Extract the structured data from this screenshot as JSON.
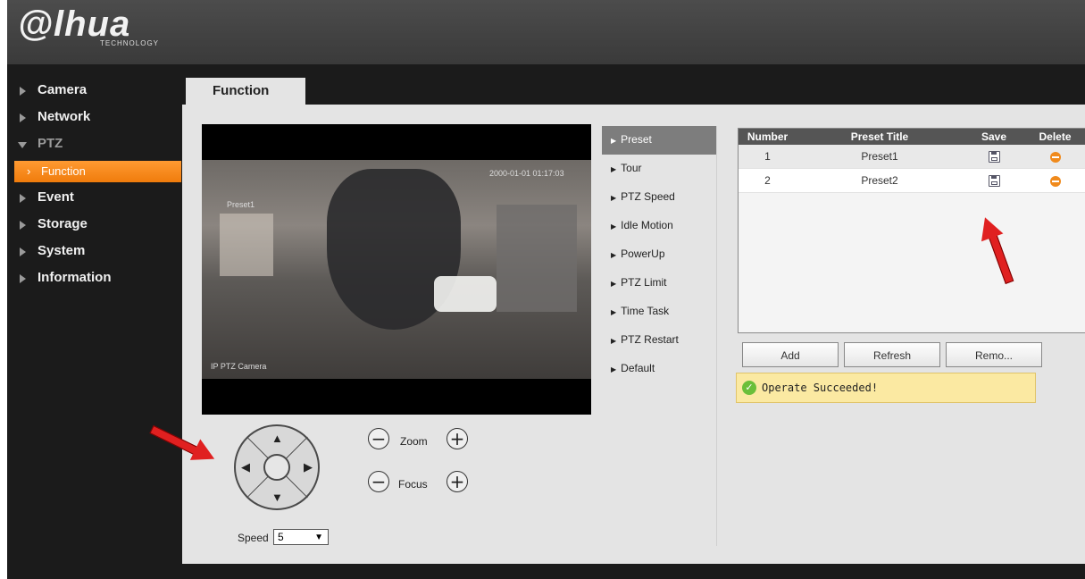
{
  "logo": {
    "main": "@lhua",
    "sub": "TECHNOLOGY"
  },
  "sidebar": {
    "items": [
      {
        "label": "Camera"
      },
      {
        "label": "Network"
      },
      {
        "label": "PTZ"
      },
      {
        "label": "Event"
      },
      {
        "label": "Storage"
      },
      {
        "label": "System"
      },
      {
        "label": "Information"
      }
    ],
    "sub_item": {
      "label": "Function"
    }
  },
  "tab": {
    "label": "Function"
  },
  "video": {
    "timestamp": "2000-01-01 01:17:03",
    "preset_osd": "Preset1",
    "camera_name": "IP PTZ Camera"
  },
  "ptz_menu": [
    {
      "label": "Preset"
    },
    {
      "label": "Tour"
    },
    {
      "label": "PTZ Speed"
    },
    {
      "label": "Idle Motion"
    },
    {
      "label": "PowerUp"
    },
    {
      "label": "PTZ Limit"
    },
    {
      "label": "Time Task"
    },
    {
      "label": "PTZ Restart"
    },
    {
      "label": "Default"
    }
  ],
  "preset_table": {
    "headers": [
      "Number",
      "Preset Title",
      "Save",
      "Delete"
    ],
    "rows": [
      {
        "number": "1",
        "title": "Preset1"
      },
      {
        "number": "2",
        "title": "Preset2"
      }
    ]
  },
  "buttons": {
    "add": "Add",
    "refresh": "Refresh",
    "remove": "Remo..."
  },
  "message": {
    "text": "Operate Succeeded!"
  },
  "controls": {
    "zoom_label": "Zoom",
    "focus_label": "Focus",
    "speed_label": "Speed",
    "speed_value": "5",
    "minus": "−",
    "plus": "+",
    "up": "▲",
    "down": "▼",
    "left": "◀",
    "right": "▶"
  },
  "colors": {
    "accent": "#f07c0c",
    "annotation_arrow": "#e02020"
  },
  "icons": [
    "save-icon",
    "delete-icon",
    "check-icon",
    "dropdown-caret-icon"
  ]
}
